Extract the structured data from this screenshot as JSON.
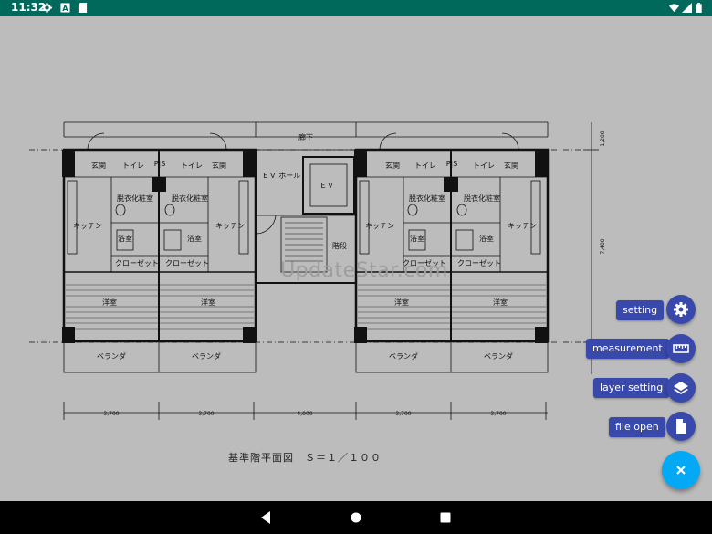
{
  "statusbar": {
    "time": "11:32",
    "icons": [
      "gear-icon",
      "a-badge-icon",
      "sd-card-icon",
      "wifi-icon",
      "signal-icon",
      "battery-icon"
    ]
  },
  "drawing": {
    "top_label": "廊下",
    "ev_hall": "ＥＶ\nホール",
    "ev": "ＥＶ",
    "stairs": "階段",
    "units": [
      {
        "genkan": "玄関",
        "toilet": "トイレ",
        "washroom": "脱衣化粧室",
        "bath": "浴室",
        "kitchen": "キッチン",
        "closet": "クローゼット",
        "room": "洋室",
        "veranda": "ベランダ"
      },
      {
        "genkan": "玄関",
        "toilet": "トイレ",
        "washroom": "脱衣化粧室",
        "bath": "浴室",
        "kitchen": "キッチン",
        "closet": "クローゼット",
        "room": "洋室",
        "veranda": "ベランダ"
      },
      {
        "genkan": "玄関",
        "toilet": "トイレ",
        "washroom": "脱衣化粧室",
        "bath": "浴室",
        "kitchen": "キッチン",
        "closet": "クローゼット",
        "room": "洋室",
        "veranda": "ベランダ"
      },
      {
        "genkan": "玄関",
        "toilet": "トイレ",
        "washroom": "脱衣化粧室",
        "bath": "浴室",
        "kitchen": "キッチン",
        "closet": "クローゼット",
        "room": "洋室",
        "veranda": "ベランダ"
      }
    ],
    "ps_labels": [
      "P|S",
      "P|S"
    ],
    "dimensions": [
      "3,700",
      "3,700",
      "4,000",
      "3,700",
      "3,700"
    ],
    "right_dims": [
      "1,200",
      "7,400"
    ],
    "caption": "基準階平面図　Ｓ＝１／１００"
  },
  "watermark": "UpdateStar.com",
  "fab_menu": [
    {
      "label": "setting",
      "icon": "gear-icon"
    },
    {
      "label": "measurement",
      "icon": "ruler-icon"
    },
    {
      "label": "layer setting",
      "icon": "layers-icon"
    },
    {
      "label": "file open",
      "icon": "file-icon"
    }
  ],
  "main_fab_icon": "close-icon",
  "colors": {
    "statusbar": "#00695c",
    "background": "#bdbdbd",
    "fab": "#3949ab",
    "main_fab": "#03a9f4"
  },
  "navbar": [
    "back-icon",
    "home-icon",
    "recents-icon"
  ]
}
